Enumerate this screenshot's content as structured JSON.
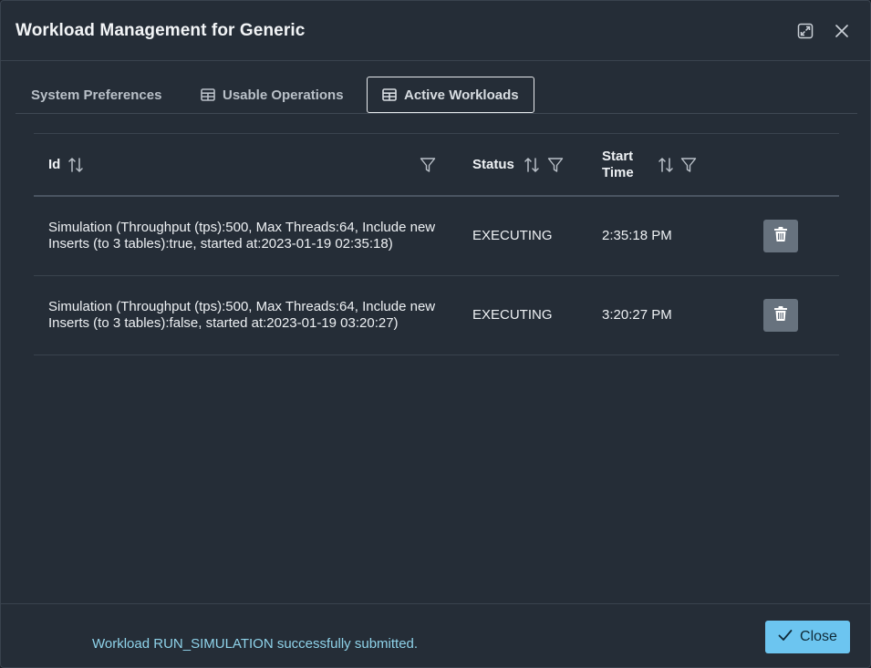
{
  "dialog": {
    "title": "Workload Management for Generic",
    "header_icons": [
      "expand-icon",
      "close-icon"
    ]
  },
  "tabs": [
    {
      "label": "System Preferences",
      "icon": null,
      "active": false
    },
    {
      "label": "Usable Operations",
      "icon": "table-icon",
      "active": false
    },
    {
      "label": "Active Workloads",
      "icon": "table-icon",
      "active": true
    }
  ],
  "table": {
    "columns": [
      {
        "label": "Id",
        "sortable": true,
        "filterable": true
      },
      {
        "label": "Status",
        "sortable": true,
        "filterable": true
      },
      {
        "label": "Start Time",
        "label_line1": "Start",
        "label_line2": "Time",
        "sortable": true,
        "filterable": true
      }
    ],
    "rows": [
      {
        "id": "Simulation (Throughput (tps):500, Max Threads:64, Include new Inserts (to 3 tables):true, started at:2023-01-19 02:35:18)",
        "status": "EXECUTING",
        "start_time": "2:35:18 PM",
        "action_icon": "trash-icon"
      },
      {
        "id": "Simulation (Throughput (tps):500, Max Threads:64, Include new Inserts (to 3 tables):false, started at:2023-01-19 03:20:27)",
        "status": "EXECUTING",
        "start_time": "3:20:27 PM",
        "action_icon": "trash-icon"
      }
    ]
  },
  "footer": {
    "message": "Workload RUN_SIMULATION successfully submitted.",
    "close_label": "Close",
    "close_icon": "check-icon"
  },
  "colors": {
    "background": "#252d37",
    "accent": "#6cc5f0",
    "message": "#8fd3ea",
    "delete_button": "#67727e"
  }
}
